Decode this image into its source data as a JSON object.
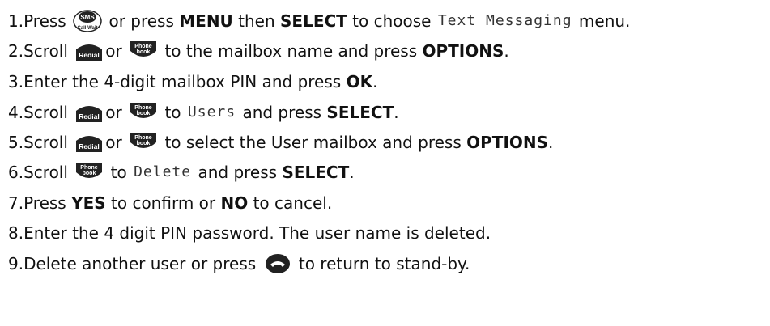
{
  "steps": [
    {
      "number": "1.",
      "parts": [
        {
          "t": "Press "
        },
        {
          "icon": "sms-callwait-key"
        },
        {
          "t": " or press "
        },
        {
          "b": "MENU"
        },
        {
          "t": " then "
        },
        {
          "b": "SELECT"
        },
        {
          "t": " to choose "
        },
        {
          "lcd": "Text Messaging"
        },
        {
          "t": " menu."
        }
      ]
    },
    {
      "number": "2.",
      "parts": [
        {
          "t": "Scroll "
        },
        {
          "icon": "redial-key"
        },
        {
          "t": "or "
        },
        {
          "icon": "phonebook-key"
        },
        {
          "t": " to the mailbox name and press "
        },
        {
          "b": "OPTIONS"
        },
        {
          "t": "."
        }
      ]
    },
    {
      "number": "3.",
      "parts": [
        {
          "t": "Enter the 4-digit mailbox PIN and press "
        },
        {
          "b": "OK"
        },
        {
          "t": "."
        }
      ]
    },
    {
      "number": "4.",
      "parts": [
        {
          "t": "Scroll "
        },
        {
          "icon": "redial-key"
        },
        {
          "t": "or "
        },
        {
          "icon": "phonebook-key"
        },
        {
          "t": " to "
        },
        {
          "lcd": "Users"
        },
        {
          "t": " and press "
        },
        {
          "b": "SELECT"
        },
        {
          "t": "."
        }
      ]
    },
    {
      "number": "5.",
      "parts": [
        {
          "t": "Scroll "
        },
        {
          "icon": "redial-key"
        },
        {
          "t": "or "
        },
        {
          "icon": "phonebook-key"
        },
        {
          "t": " to select the User mailbox and press "
        },
        {
          "b": "OPTIONS"
        },
        {
          "t": "."
        }
      ]
    },
    {
      "number": "6.",
      "parts": [
        {
          "t": "Scroll "
        },
        {
          "icon": "phonebook-key"
        },
        {
          "t": " to "
        },
        {
          "lcd": "Delete"
        },
        {
          "t": " and press "
        },
        {
          "b": "SELECT"
        },
        {
          "t": "."
        }
      ]
    },
    {
      "number": "7.",
      "parts": [
        {
          "t": "Press "
        },
        {
          "b": "YES"
        },
        {
          "t": " to confirm or "
        },
        {
          "b": "NO"
        },
        {
          "t": " to cancel."
        }
      ]
    },
    {
      "number": "8.",
      "parts": [
        {
          "t": "Enter the 4 digit PIN password. The user name is deleted."
        }
      ]
    },
    {
      "number": "9.",
      "parts": [
        {
          "t": "Delete another user or press "
        },
        {
          "icon": "end-call-key"
        },
        {
          "t": " to return to stand-by."
        }
      ]
    }
  ],
  "icons": {
    "sms-callwait-key": {
      "line1": "SMS",
      "line2": "Call Wait"
    },
    "redial-key": {
      "label": "Redial"
    },
    "phonebook-key": {
      "line1": "Phone",
      "line2": "book"
    },
    "end-call-key": {}
  }
}
